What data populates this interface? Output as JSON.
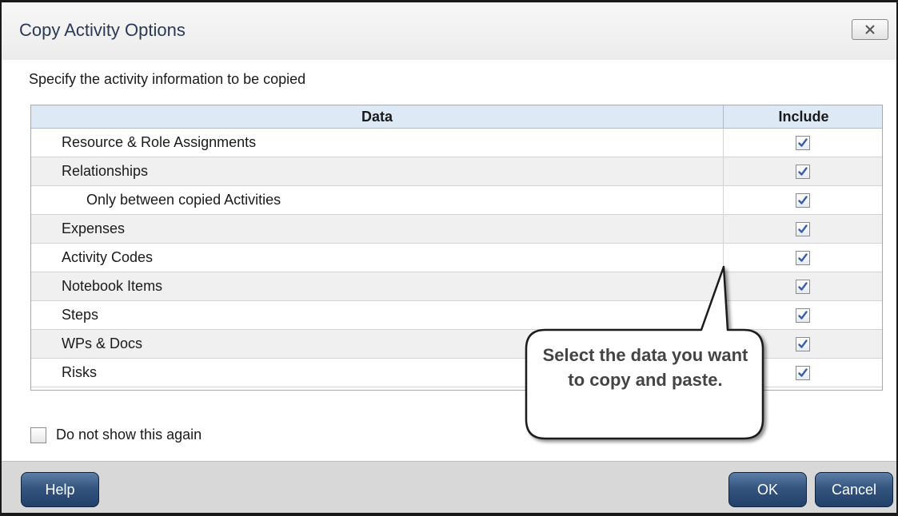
{
  "dialog": {
    "title": "Copy Activity Options",
    "close_icon": "close-x-icon",
    "instruction": "Specify the activity information to be copied"
  },
  "grid": {
    "columns": [
      "Data",
      "Include"
    ],
    "rows": [
      {
        "label": "Resource & Role Assignments",
        "include": true,
        "indent": 0
      },
      {
        "label": "Relationships",
        "include": true,
        "indent": 0
      },
      {
        "label": "Only between copied Activities",
        "include": true,
        "indent": 1
      },
      {
        "label": "Expenses",
        "include": true,
        "indent": 0
      },
      {
        "label": "Activity Codes",
        "include": true,
        "indent": 0
      },
      {
        "label": "Notebook Items",
        "include": true,
        "indent": 0
      },
      {
        "label": "Steps",
        "include": true,
        "indent": 0
      },
      {
        "label": "WPs & Docs",
        "include": true,
        "indent": 0
      },
      {
        "label": "Risks",
        "include": true,
        "indent": 0
      }
    ]
  },
  "options": {
    "do_not_show_label": "Do not show this again",
    "do_not_show_checked": false
  },
  "buttons": {
    "help": "Help",
    "ok": "OK",
    "cancel": "Cancel"
  },
  "callout": {
    "text": "Select the data you want to copy and paste."
  },
  "colors": {
    "title_text": "#2a3a55",
    "header_bg": "#ddeaf6",
    "button_bg": "#34557f",
    "checkmark": "#3a5fa8"
  }
}
